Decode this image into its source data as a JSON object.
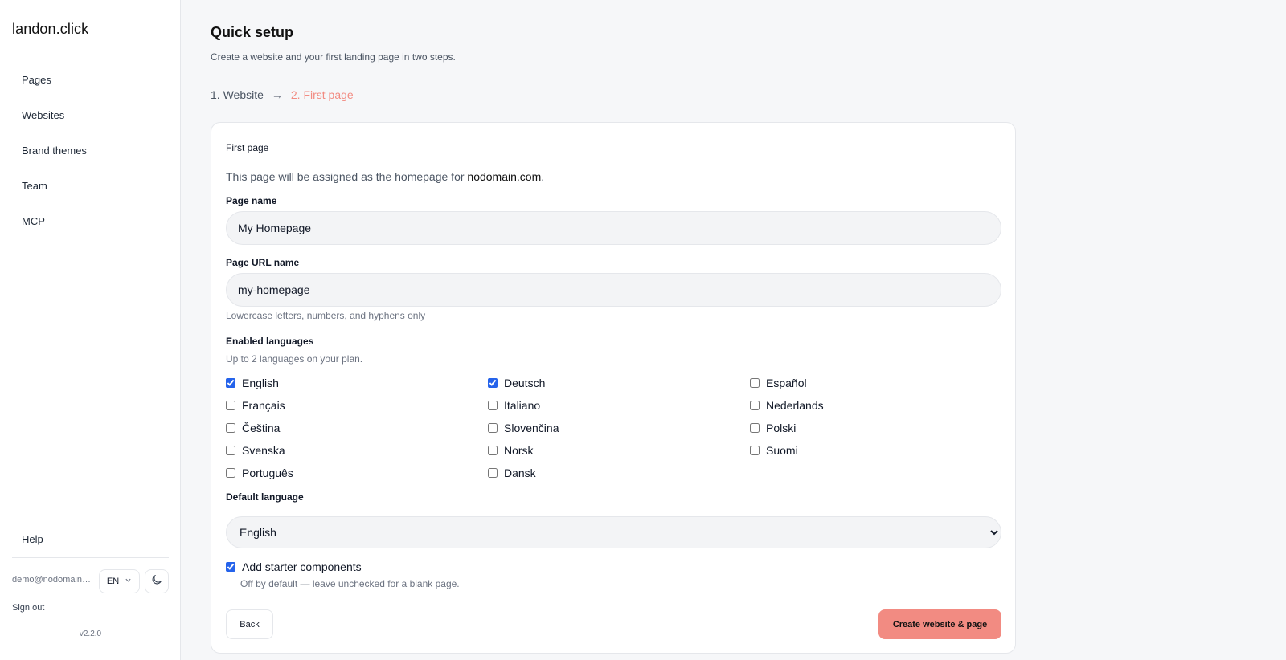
{
  "app": {
    "brand": "landon.click",
    "version": "v2.2.0"
  },
  "sidebar": {
    "items": [
      {
        "label": "Pages"
      },
      {
        "label": "Websites"
      },
      {
        "label": "Brand themes"
      },
      {
        "label": "Team"
      },
      {
        "label": "MCP"
      }
    ],
    "help": "Help",
    "user_email": "demo@nodomain.com",
    "language": "EN",
    "theme_icon": "moon-icon",
    "sign_out": "Sign out"
  },
  "header": {
    "title": "Quick setup",
    "subtitle": "Create a website and your first landing page in two steps.",
    "steps": [
      "1. Website",
      "2. First page"
    ],
    "step_arrow": "→",
    "active_step_color": "#f28b82"
  },
  "form": {
    "card_title": "First page",
    "assign_prefix": "This page will be assigned as the homepage for ",
    "domain": "nodomain.com",
    "assign_suffix": ".",
    "page_name": {
      "label": "Page name",
      "value": "My Homepage"
    },
    "page_url": {
      "label": "Page URL name",
      "value": "my-homepage",
      "hint": "Lowercase letters, numbers, and hyphens only"
    },
    "languages": {
      "label": "Enabled languages",
      "hint": "Up to 2 languages on your plan.",
      "options": [
        {
          "name": "English",
          "checked": true
        },
        {
          "name": "Deutsch",
          "checked": true
        },
        {
          "name": "Español",
          "checked": false
        },
        {
          "name": "Français",
          "checked": false
        },
        {
          "name": "Italiano",
          "checked": false
        },
        {
          "name": "Nederlands",
          "checked": false
        },
        {
          "name": "Čeština",
          "checked": false
        },
        {
          "name": "Slovenčina",
          "checked": false
        },
        {
          "name": "Polski",
          "checked": false
        },
        {
          "name": "Svenska",
          "checked": false
        },
        {
          "name": "Norsk",
          "checked": false
        },
        {
          "name": "Suomi",
          "checked": false
        },
        {
          "name": "Português",
          "checked": false
        },
        {
          "name": "Dansk",
          "checked": false
        }
      ]
    },
    "default_language": {
      "label": "Default language",
      "value": "English"
    },
    "starter": {
      "label": "Add starter components",
      "checked": true,
      "hint": "Off by default — leave unchecked for a blank page."
    },
    "back_label": "Back",
    "create_label": "Create website & page"
  }
}
